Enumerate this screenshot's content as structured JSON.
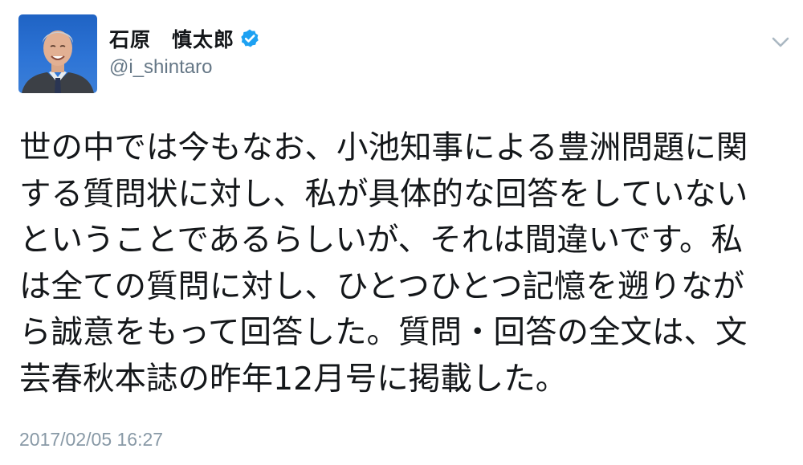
{
  "tweet": {
    "author": {
      "display_name": "石原　慎太郎",
      "handle": "@i_shintaro",
      "verified": true,
      "avatar_icon": "profile-photo"
    },
    "menu_icon": "chevron-down-icon",
    "text_lines": [
      "世の中では今もなお、小池知事による豊洲問題に関",
      "する質問状に対し、私が具体的な回答をしていない",
      "ということであるらしいが、それは間違いです。私",
      "は全ての質問に対し、ひとつひとつ記憶を遡りなが",
      "ら誠意をもって回答した。質問・回答の全文は、文",
      "芸春秋本誌の昨年12月号に掲載した。"
    ],
    "timestamp": "2017/02/05 16:27",
    "colors": {
      "verified": "#1da1f2",
      "handle": "#657786",
      "timestamp": "#8899a6",
      "text": "#14171a"
    }
  }
}
